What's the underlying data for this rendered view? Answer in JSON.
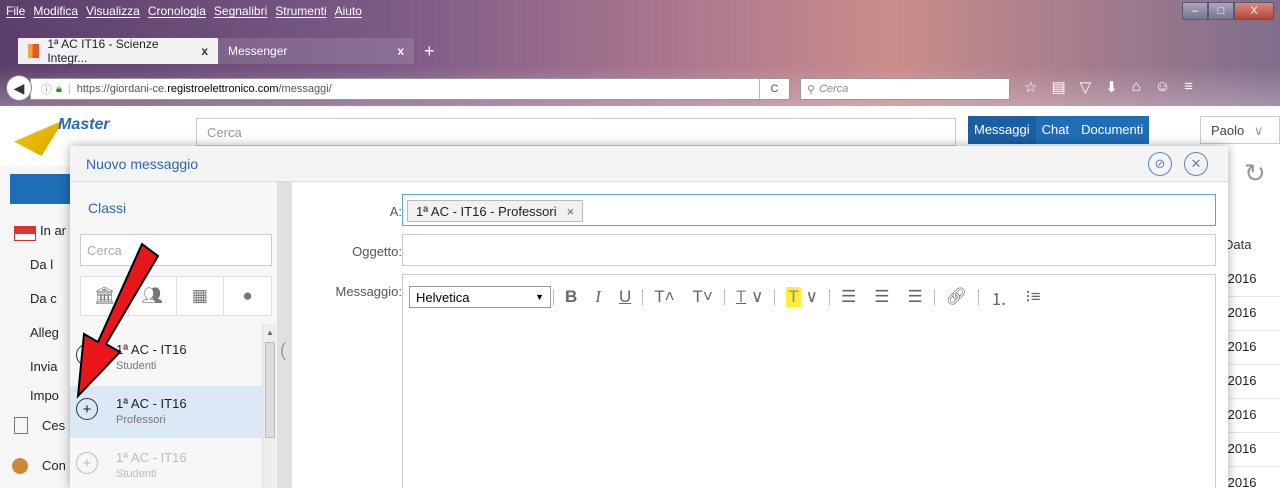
{
  "browser": {
    "menu": [
      "File",
      "Modifica",
      "Visualizza",
      "Cronologia",
      "Segnalibri",
      "Strumenti",
      "Aiuto"
    ],
    "window_controls": {
      "minimize": "–",
      "maximize": "□",
      "close": "X"
    },
    "tabs": [
      {
        "title": "1ª AC IT16 - Scienze Integr...",
        "close": "x"
      },
      {
        "title": "Messenger",
        "close": "x"
      }
    ],
    "new_tab": "+",
    "url": {
      "prefix": "https://giordani-ce.",
      "domain": "registroelettronico.com",
      "path": "/messaggi/"
    },
    "search_placeholder": "Cerca"
  },
  "app": {
    "logo_text": "Master",
    "search_placeholder": "Cerca",
    "nav": [
      "Messaggi",
      "Chat",
      "Documenti"
    ],
    "user": "Paolo",
    "sidebar_labels": [
      "In ar",
      "Da l",
      "Da c",
      "Alleg",
      "Invia",
      "Impo",
      "Ces",
      "Con"
    ],
    "list_header": "Data",
    "dates": [
      "/2016",
      "/2016",
      "/2016",
      "/2016",
      "/2016",
      "/2016",
      "/2016"
    ]
  },
  "modal": {
    "title": "Nuovo messaggio",
    "sidebar": {
      "title": "Classi",
      "search_placeholder": "Cerca",
      "items": [
        {
          "line1": "1ª AC - IT16",
          "line2": "Studenti",
          "selected": false,
          "dim": false
        },
        {
          "line1": "1ª AC - IT16",
          "line2": "Professori",
          "selected": true,
          "dim": false
        },
        {
          "line1": "1ª AC - IT16",
          "line2": "Studenti",
          "selected": false,
          "dim": true
        }
      ]
    },
    "form": {
      "to_label": "A:",
      "to_chip": "1ª AC - IT16 - Professori",
      "to_chip_remove": "×",
      "subject_label": "Oggetto:",
      "message_label": "Messaggio:",
      "font": "Helvetica"
    }
  },
  "colors": {
    "accent": "#1f6db6",
    "link": "#2a67b0",
    "arrow": "#e8161a",
    "highlight": "#ffef3b"
  }
}
